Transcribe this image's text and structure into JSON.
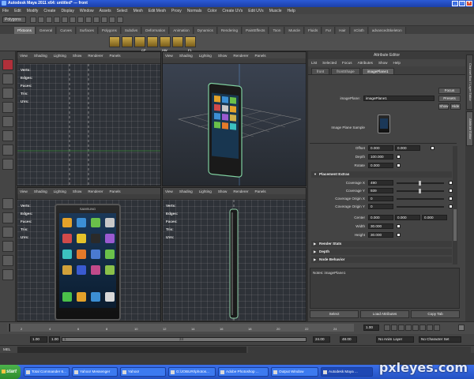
{
  "window": {
    "title": "Autodesk Maya 2011 x64: untitled*  ---  front"
  },
  "menubar": [
    "File",
    "Edit",
    "Modify",
    "Create",
    "Display",
    "Window",
    "Assets",
    "Select",
    "Mesh",
    "Edit Mesh",
    "Proxy",
    "Normals",
    "Color",
    "Create UVs",
    "Edit UVs",
    "Muscle",
    "Help"
  ],
  "statusline": {
    "mode": "Polygons"
  },
  "shelf": {
    "tabs": [
      "Pfxtoons",
      "General",
      "Curves",
      "Surfaces",
      "Polygons",
      "Subdivs",
      "Deformation",
      "Animation",
      "Dynamics",
      "Rendering",
      "PaintEffects",
      "Toon",
      "Muscle",
      "Fluids",
      "Fur",
      "Hair",
      "nCloth",
      "advancedSkeleton"
    ],
    "active_tab": "Pfxtoons",
    "icons": [
      {
        "name": "shelf-icon-1",
        "label": ""
      },
      {
        "name": "shelf-icon-2",
        "label": ""
      },
      {
        "name": "shelf-icon-3",
        "label": "CP"
      },
      {
        "name": "shelf-icon-4",
        "label": ""
      },
      {
        "name": "shelf-icon-5",
        "label": "HW"
      },
      {
        "name": "shelf-icon-6",
        "label": ""
      },
      {
        "name": "shelf-icon-7",
        "label": "F1"
      }
    ]
  },
  "viewport_menu": [
    "View",
    "Shading",
    "Lighting",
    "Show",
    "Renderer",
    "Panels"
  ],
  "hud": {
    "verts": "Verts:",
    "edges": "Edges:",
    "faces": "Faces:",
    "tris": "Tris:",
    "uvs": "UVs:"
  },
  "viewports": [
    {
      "id": "top-left",
      "label": ""
    },
    {
      "id": "top-right",
      "label": ""
    },
    {
      "id": "bottom-left",
      "label": ""
    },
    {
      "id": "bottom-right",
      "label": ""
    }
  ],
  "phone": {
    "brand": "SAMSUNG"
  },
  "attribute_editor": {
    "title": "Attribute Editor",
    "menu": [
      "List",
      "Selected",
      "Focus",
      "Attributes",
      "Show",
      "Help"
    ],
    "tabs": [
      "front",
      "frontShape",
      "imagePlane1"
    ],
    "active_tab": "imagePlane1",
    "node_label": "imagePlane:",
    "node_value": "imagePlane1",
    "buttons": {
      "focus": "Focus",
      "presets": "Presets",
      "show": "Show",
      "hide": "Hide"
    },
    "sample_label": "Image Plane Sample",
    "offset_label": "Offset",
    "offset_x": "0.000",
    "offset_y": "0.000",
    "depth_label": "Depth",
    "depth_value": "100.000",
    "rotate_label": "Rotate",
    "rotate_value": "0.000",
    "placement_section": "Placement Extras",
    "coverage_x_label": "Coverage X",
    "coverage_x_value": "490",
    "coverage_y_label": "Coverage Y",
    "coverage_y_value": "939",
    "origin_x_label": "Coverage Origin X",
    "origin_x_value": "0",
    "origin_y_label": "Coverage Origin Y",
    "origin_y_value": "0",
    "center_label": "Center",
    "center_values": [
      "0.000",
      "0.000",
      "0.000"
    ],
    "width_label": "Width",
    "width_value": "30.000",
    "height_label": "Height",
    "height_value": "30.000",
    "sections": [
      "Render Stats",
      "Depth",
      "Node Behavior"
    ],
    "notes_label": "Notes: imagePlane1",
    "bottom_buttons": [
      "Select",
      "Load Attributes",
      "Copy Tab"
    ],
    "slider_values": {
      "coverage_x": "0",
      "coverage_y": "0"
    }
  },
  "side_tabs": [
    "Channel Box / Layer Editor",
    "Attribute Editor"
  ],
  "timeline": {
    "ticks": [
      "2",
      "4",
      "6",
      "8",
      "10",
      "12",
      "14",
      "16",
      "18",
      "20",
      "22",
      "24"
    ],
    "current_frame": "1.00"
  },
  "range": {
    "start": "1.00",
    "inner_start": "1.00",
    "bar_start": "1",
    "bar_end": "24",
    "end_time": "24.00",
    "anim_end": "48.00",
    "anim_layer": "No Anim Layer",
    "char_set": "No Character Set"
  },
  "cmdline": {
    "label": "MEL"
  },
  "taskbar": {
    "start": "start",
    "tasks": [
      {
        "label": "Total Commander 6...",
        "active": false
      },
      {
        "label": "Yahoo! Messenger",
        "active": false
      },
      {
        "label": "Yahoo!",
        "active": false
      },
      {
        "label": "G:\\JOBURI\\photos...",
        "active": false
      },
      {
        "label": "Adobe Photoshop ...",
        "active": false
      },
      {
        "label": "Output Window",
        "active": false
      },
      {
        "label": "Autodesk Maya ...",
        "active": true
      }
    ]
  },
  "watermark": "pxleyes.com"
}
